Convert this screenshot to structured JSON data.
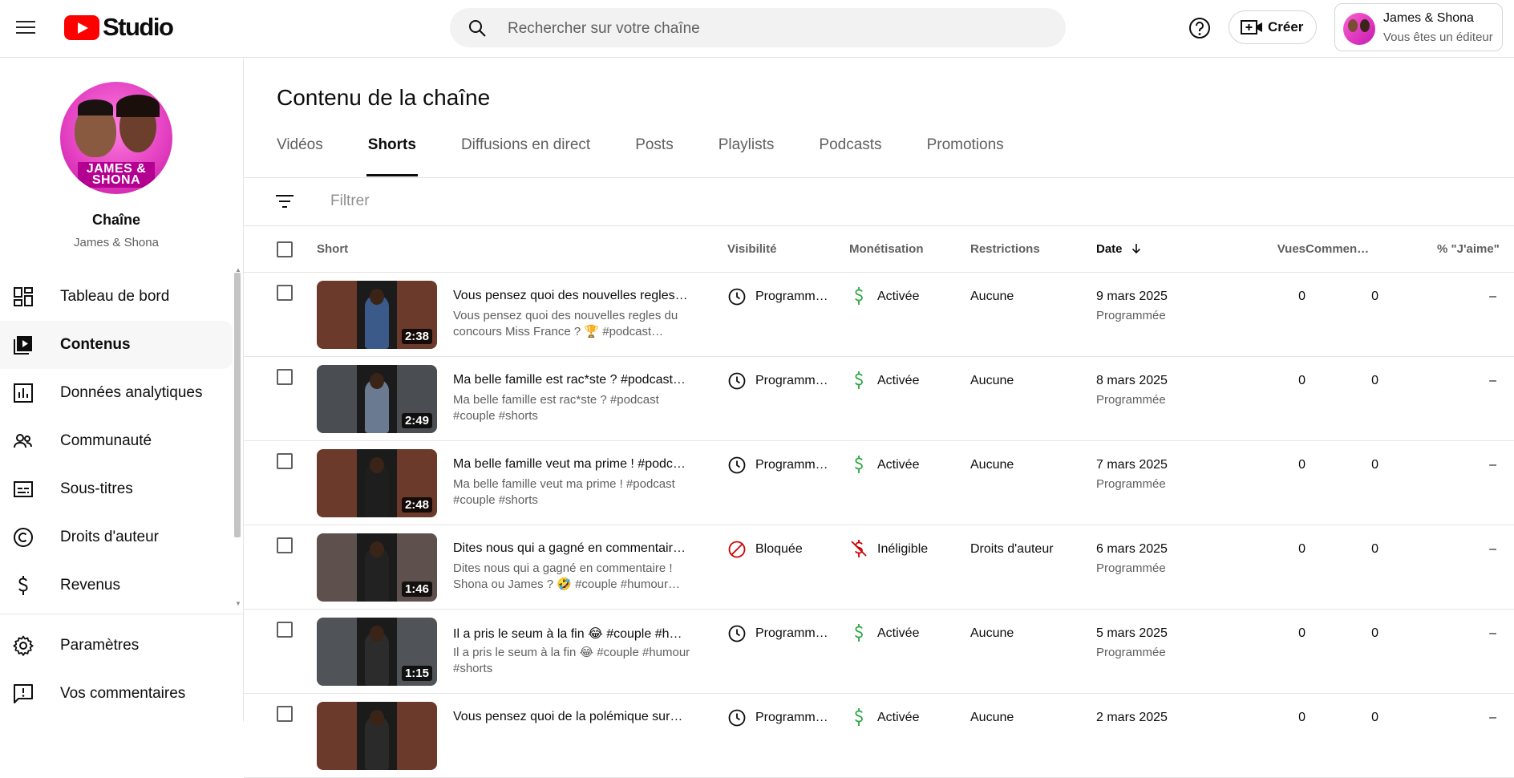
{
  "header": {
    "logo_text": "Studio",
    "search_placeholder": "Rechercher sur votre chaîne",
    "create_label": "Créer",
    "account": {
      "name": "James & Shona",
      "role": "Vous êtes un éditeur"
    }
  },
  "sidebar": {
    "channel_title": "Chaîne",
    "channel_name": "James & Shona",
    "channel_logo_text": "JAMES & SHONA",
    "items": [
      {
        "label": "Tableau de bord",
        "icon": "dashboard-icon",
        "active": false
      },
      {
        "label": "Contenus",
        "icon": "content-icon",
        "active": true
      },
      {
        "label": "Données analytiques",
        "icon": "analytics-icon",
        "active": false
      },
      {
        "label": "Communauté",
        "icon": "community-icon",
        "active": false
      },
      {
        "label": "Sous-titres",
        "icon": "subtitles-icon",
        "active": false
      },
      {
        "label": "Droits d'auteur",
        "icon": "copyright-icon",
        "active": false
      },
      {
        "label": "Revenus",
        "icon": "dollar-icon",
        "active": false
      }
    ],
    "bottom_items": [
      {
        "label": "Paramètres",
        "icon": "gear-icon"
      },
      {
        "label": "Vos commentaires",
        "icon": "feedback-icon"
      }
    ]
  },
  "main": {
    "title": "Contenu de la chaîne",
    "tabs": [
      {
        "label": "Vidéos",
        "active": false
      },
      {
        "label": "Shorts",
        "active": true
      },
      {
        "label": "Diffusions en direct",
        "active": false
      },
      {
        "label": "Posts",
        "active": false
      },
      {
        "label": "Playlists",
        "active": false
      },
      {
        "label": "Podcasts",
        "active": false
      },
      {
        "label": "Promotions",
        "active": false
      }
    ],
    "filter_placeholder": "Filtrer",
    "columns": {
      "short": "Short",
      "visibility": "Visibilité",
      "monetization": "Monétisation",
      "restrictions": "Restrictions",
      "date": "Date",
      "views": "Vues",
      "comments": "Commen…",
      "likes": "% \"J'aime\""
    },
    "rows": [
      {
        "title": "Vous pensez quoi des nouvelles regles…",
        "description": "Vous pensez quoi des nouvelles regles du concours Miss France ? 🏆 #podcast…",
        "duration": "2:38",
        "visibility": "Programm…",
        "visibility_type": "scheduled",
        "monetization": "Activée",
        "monetization_type": "on",
        "restrictions": "Aucune",
        "date": "9 mars 2025",
        "date_status": "Programmée",
        "views": "0",
        "comments": "0",
        "likes": "–",
        "thumb_bg": "#6b3a2a",
        "thumb_fig": "#3b5a8a"
      },
      {
        "title": "Ma belle famille est rac*ste ? #podcast…",
        "description": "Ma belle famille est rac*ste ? #podcast #couple #shorts",
        "duration": "2:49",
        "visibility": "Programm…",
        "visibility_type": "scheduled",
        "monetization": "Activée",
        "monetization_type": "on",
        "restrictions": "Aucune",
        "date": "8 mars 2025",
        "date_status": "Programmée",
        "views": "0",
        "comments": "0",
        "likes": "–",
        "thumb_bg": "#4a4e52",
        "thumb_fig": "#6a7a90"
      },
      {
        "title": "Ma belle famille veut ma prime ! #podc…",
        "description": "Ma belle famille veut ma prime ! #podcast #couple #shorts",
        "duration": "2:48",
        "visibility": "Programm…",
        "visibility_type": "scheduled",
        "monetization": "Activée",
        "monetization_type": "on",
        "restrictions": "Aucune",
        "date": "7 mars 2025",
        "date_status": "Programmée",
        "views": "0",
        "comments": "0",
        "likes": "–",
        "thumb_bg": "#6b3a2a",
        "thumb_fig": "#1e1e1e"
      },
      {
        "title": "Dites nous qui a gagné en commentair…",
        "description": "Dites nous qui a gagné en commentaire ! Shona ou James ? 🤣 #couple #humour…",
        "duration": "1:46",
        "visibility": "Bloquée",
        "visibility_type": "blocked",
        "monetization": "Inéligible",
        "monetization_type": "off",
        "restrictions": "Droits d'auteur",
        "date": "6 mars 2025",
        "date_status": "Programmée",
        "views": "0",
        "comments": "0",
        "likes": "–",
        "thumb_bg": "#5e504c",
        "thumb_fig": "#222222"
      },
      {
        "title": "Il a pris le seum à la fin 😂 #couple #h…",
        "description": "Il a pris le seum à la fin 😂 #couple #humour #shorts",
        "duration": "1:15",
        "visibility": "Programm…",
        "visibility_type": "scheduled",
        "monetization": "Activée",
        "monetization_type": "on",
        "restrictions": "Aucune",
        "date": "5 mars 2025",
        "date_status": "Programmée",
        "views": "0",
        "comments": "0",
        "likes": "–",
        "thumb_bg": "#505458",
        "thumb_fig": "#2c2c2c"
      },
      {
        "title": "Vous pensez quoi de la polémique sur…",
        "description": "",
        "duration": "",
        "visibility": "Programm…",
        "visibility_type": "scheduled",
        "monetization": "Activée",
        "monetization_type": "on",
        "restrictions": "Aucune",
        "date": "2 mars 2025",
        "date_status": "",
        "views": "0",
        "comments": "0",
        "likes": "–",
        "thumb_bg": "#6b3a2a",
        "thumb_fig": "#2a2a2a"
      }
    ]
  }
}
